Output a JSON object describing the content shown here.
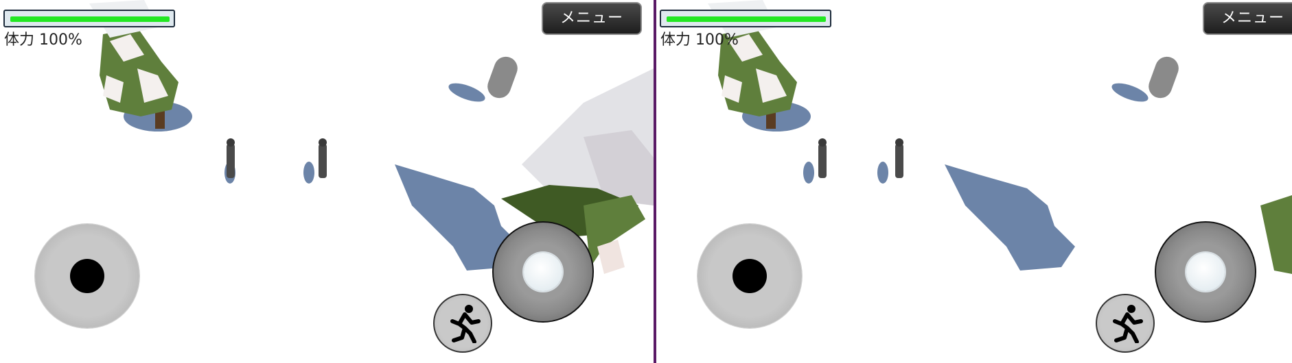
{
  "panes": [
    {
      "id": "left",
      "health": {
        "label": "体力 100%",
        "percent": 100
      },
      "menu": {
        "label": "メニュー"
      }
    },
    {
      "id": "right",
      "health": {
        "label": "体力 100%",
        "percent": 100
      },
      "menu": {
        "label": "メニュー"
      }
    }
  ],
  "icons": {
    "run": "running-person-icon"
  },
  "colors": {
    "health_fill": "#22e822",
    "divider": "#5a1a66",
    "shadow": "#6c84a8",
    "foliage": "#5f7f3c"
  }
}
